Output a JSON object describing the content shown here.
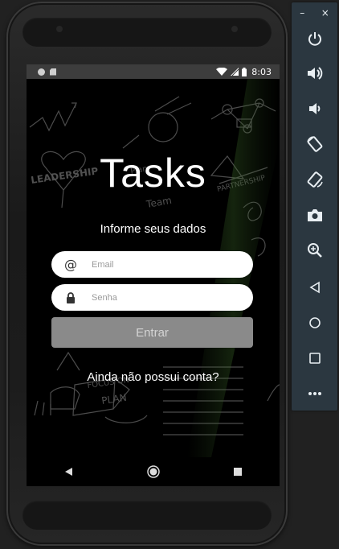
{
  "statusbar": {
    "time": "8:03"
  },
  "app": {
    "title": "Tasks",
    "subtitle": "Informe seus dados",
    "email": {
      "placeholder": "Email",
      "icon": "at-icon"
    },
    "password": {
      "placeholder": "Senha",
      "icon": "lock-icon"
    },
    "submit_label": "Entrar",
    "signup_label": "Ainda não possui conta?",
    "background_words": [
      "LEADERSHIP",
      "PARTNERSHIP",
      "FOCUS ON",
      "PLAN",
      "Plan",
      "Team"
    ]
  },
  "navbar": {
    "back_icon": "back-triangle-icon",
    "home_icon": "home-circle-icon",
    "recent_icon": "recent-square-icon"
  },
  "toolbar": {
    "minimize": "–",
    "close": "×",
    "buttons": [
      "power-icon",
      "volume-up-icon",
      "volume-down-icon",
      "rotate-left-icon",
      "rotate-right-icon",
      "camera-icon",
      "zoom-icon",
      "back-icon",
      "home-icon",
      "overview-icon",
      "more-icon"
    ]
  },
  "colors": {
    "button_bg": "#8a8a8a",
    "status_bar": "#3d3d3d",
    "toolbar_bg": "#2b3740"
  }
}
